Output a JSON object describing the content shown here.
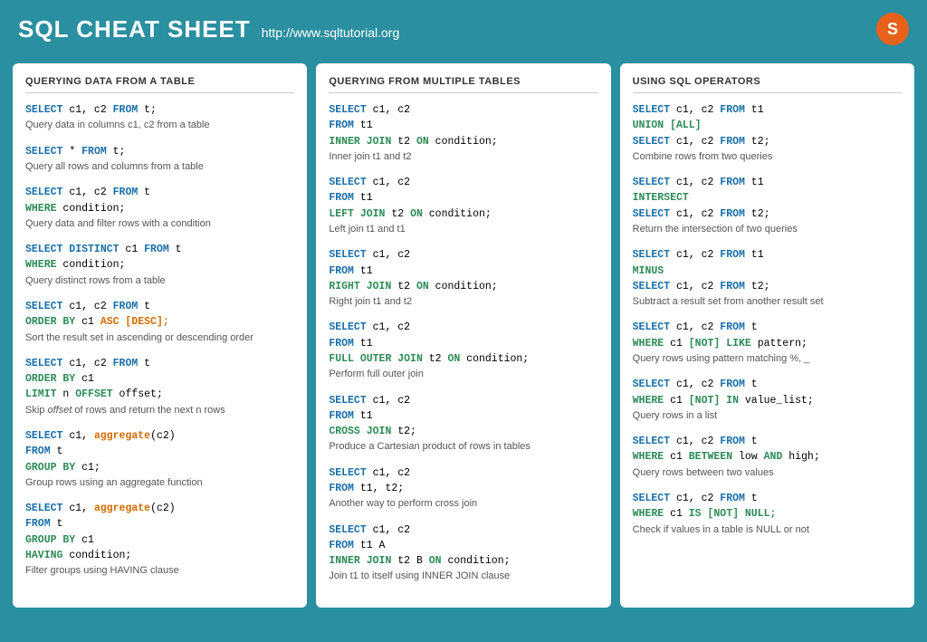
{
  "header": {
    "title": "SQL CHEAT SHEET",
    "url": "http://www.sqltutorial.org",
    "logo": "S"
  },
  "panels": [
    {
      "id": "panel-1",
      "title": "QUERYING DATA FROM A TABLE",
      "sections": [
        {
          "code": [
            "SELECT c1, c2 FROM t;"
          ],
          "desc": "Query data in columns c1, c2 from a table"
        },
        {
          "code": [
            "SELECT * FROM t;"
          ],
          "desc": "Query all rows and columns from a table"
        },
        {
          "code": [
            "SELECT c1, c2 FROM t",
            "WHERE condition;"
          ],
          "desc": "Query data and filter rows with a condition"
        },
        {
          "code": [
            "SELECT DISTINCT c1 FROM t",
            "WHERE condition;"
          ],
          "desc": "Query distinct rows from a table"
        },
        {
          "code": [
            "SELECT c1, c2 FROM t",
            "ORDER BY c1 ASC [DESC];"
          ],
          "desc": "Sort the result set in ascending or descending order"
        },
        {
          "code": [
            "SELECT c1, c2 FROM t",
            "ORDER BY c1",
            "LIMIT n OFFSET offset;"
          ],
          "desc": "Skip offset of rows and return the next n rows"
        },
        {
          "code": [
            "SELECT c1, aggregate(c2)",
            "FROM t",
            "GROUP BY c1;"
          ],
          "desc": "Group rows using an aggregate function"
        },
        {
          "code": [
            "SELECT c1, aggregate(c2)",
            "FROM t",
            "GROUP BY c1",
            "HAVING condition;"
          ],
          "desc": "Filter groups using HAVING clause"
        }
      ]
    },
    {
      "id": "panel-2",
      "title": "QUERYING FROM MULTIPLE TABLES",
      "sections": [
        {
          "code": [
            "SELECT c1, c2",
            "FROM t1",
            "INNER JOIN t2 ON condition;"
          ],
          "desc": "Inner join t1 and t2"
        },
        {
          "code": [
            "SELECT c1, c2",
            "FROM t1",
            "LEFT JOIN t2 ON condition;"
          ],
          "desc": "Left join t1 and t1"
        },
        {
          "code": [
            "SELECT c1, c2",
            "FROM t1",
            "RIGHT JOIN t2 ON condition;"
          ],
          "desc": "Right join t1 and t2"
        },
        {
          "code": [
            "SELECT c1, c2",
            "FROM t1",
            "FULL OUTER JOIN t2 ON condition;"
          ],
          "desc": "Perform full outer join"
        },
        {
          "code": [
            "SELECT c1, c2",
            "FROM t1",
            "CROSS JOIN t2;"
          ],
          "desc": "Produce a Cartesian product of rows in tables"
        },
        {
          "code": [
            "SELECT c1, c2",
            "FROM t1, t2;"
          ],
          "desc": "Another way to perform cross join"
        },
        {
          "code": [
            "SELECT c1, c2",
            "FROM t1 A",
            "INNER JOIN t2 B ON condition;"
          ],
          "desc": "Join t1 to itself using INNER JOIN clause"
        }
      ]
    },
    {
      "id": "panel-3",
      "title": "USING SQL OPERATORS",
      "sections": [
        {
          "code": [
            "SELECT c1, c2 FROM t1",
            "UNION [ALL]",
            "SELECT c1, c2 FROM t2;"
          ],
          "desc": "Combine rows from two queries"
        },
        {
          "code": [
            "SELECT c1, c2 FROM t1",
            "INTERSECT",
            "SELECT c1, c2 FROM t2;"
          ],
          "desc": "Return the intersection of two queries"
        },
        {
          "code": [
            "SELECT c1, c2 FROM t1",
            "MINUS",
            "SELECT c1, c2 FROM t2;"
          ],
          "desc": "Subtract a result set from another result set"
        },
        {
          "code": [
            "SELECT c1, c2 FROM t",
            "WHERE c1 [NOT] LIKE pattern;"
          ],
          "desc": "Query rows using pattern matching %, _"
        },
        {
          "code": [
            "SELECT c1, c2 FROM t",
            "WHERE c1 [NOT] IN value_list;"
          ],
          "desc": "Query rows in a list"
        },
        {
          "code": [
            "SELECT c1, c2 FROM t",
            "WHERE c1 BETWEEN low AND high;"
          ],
          "desc": "Query rows between two values"
        },
        {
          "code": [
            "SELECT c1, c2 FROM t",
            "WHERE c1 IS [NOT] NULL;"
          ],
          "desc": "Check if values in a table is NULL or not"
        }
      ]
    }
  ]
}
